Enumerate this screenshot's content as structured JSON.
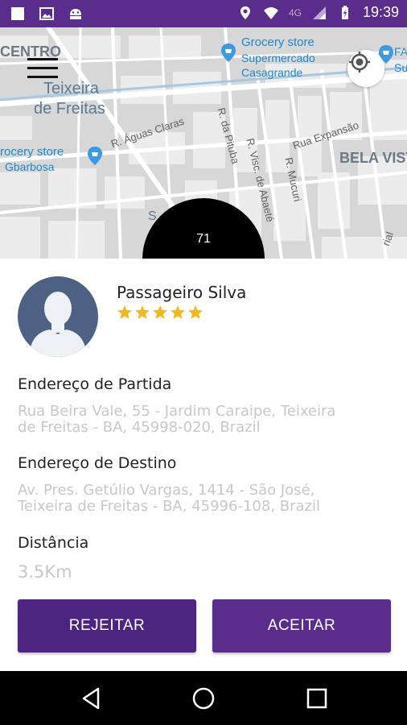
{
  "status_bar": {
    "network": "4G",
    "time": "19:39",
    "icons": [
      "square-icon",
      "image-icon",
      "android-icon",
      "location-icon",
      "wifi-icon",
      "signal-icon",
      "battery-icon"
    ]
  },
  "map": {
    "district_centro": "CENTRO",
    "district_teixeira_line1": "Teixeira",
    "district_teixeira_line2": "de Freitas",
    "district_bela_vista": "BELA VIST",
    "poi_grocery_1_name": "Grocery store",
    "poi_grocery_1_sub1": "Supermercado",
    "poi_grocery_1_sub2": "Casagrande",
    "poi_grocery_2_name": "rocery store",
    "poi_grocery_2_sub": "Gbarbosa",
    "poi_fa": "FA",
    "poi_su": "Su",
    "street_aguas_claras": "R. Águas Claras",
    "street_pituba": "R. da Pituba",
    "street_abaete": "R. Visc. de Abaeté",
    "street_mucuri": "R. Mucuri",
    "street_expansao": "Rua Expansão",
    "street_s": "S",
    "street_rial": "rial",
    "counter_value": "71"
  },
  "passenger": {
    "name": "Passageiro Silva",
    "rating": 5
  },
  "trip": {
    "departure_label": "Endereço de Partida",
    "departure_line1": "Rua Beira Vale, 55 - Jardim Caraipe, Teixeira",
    "departure_line2": "de Freitas - BA, 45998-020, Brazil",
    "destination_label": "Endereço de Destino",
    "destination_line1": "Av. Pres. Getúlio Vargas, 1414 - São José,",
    "destination_line2": "Teixeira de Freitas - BA, 45996-108, Brazil",
    "distance_label": "Distância",
    "distance_value": "3.5Km"
  },
  "actions": {
    "reject_label": "REJEITAR",
    "accept_label": "ACEITAR"
  },
  "colors": {
    "primary": "#5a2d8c",
    "primary_dark": "#4d2480",
    "star": "#f5b81c",
    "avatar_bg": "#4d6185",
    "poi": "#1e88c8"
  }
}
